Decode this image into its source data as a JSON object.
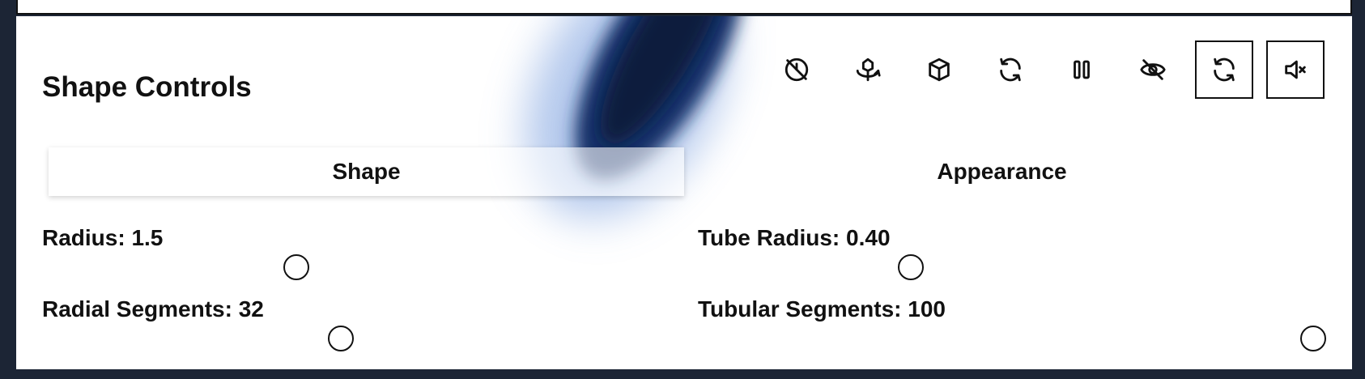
{
  "panel": {
    "title": "Shape Controls"
  },
  "toolbar": [
    {
      "icon": "timer-off-icon",
      "action": "toggle-timer"
    },
    {
      "icon": "rotate-3d-icon",
      "action": "rotate"
    },
    {
      "icon": "box-icon",
      "action": "toggle-mesh"
    },
    {
      "icon": "refresh-icon",
      "action": "refresh"
    },
    {
      "icon": "pause-icon",
      "action": "pause"
    },
    {
      "icon": "eye-off-icon",
      "action": "hide"
    },
    {
      "icon": "refresh-icon",
      "action": "reset"
    },
    {
      "icon": "volume-mute-icon",
      "action": "mute"
    }
  ],
  "tabs": [
    {
      "label": "Shape",
      "active": true
    },
    {
      "label": "Appearance",
      "active": false
    }
  ],
  "controls": {
    "radius": {
      "label": "Radius: 1.5",
      "value": 1.5
    },
    "tube_radius": {
      "label": "Tube Radius: 0.40",
      "value": 0.4
    },
    "radial_segments": {
      "label": "Radial Segments: 32",
      "value": 32
    },
    "tubular_segments": {
      "label": "Tubular Segments: 100",
      "value": 100
    }
  },
  "colors": {
    "background": "#1c2535",
    "panel": "#ffffff",
    "accent": "#1a3a78"
  }
}
